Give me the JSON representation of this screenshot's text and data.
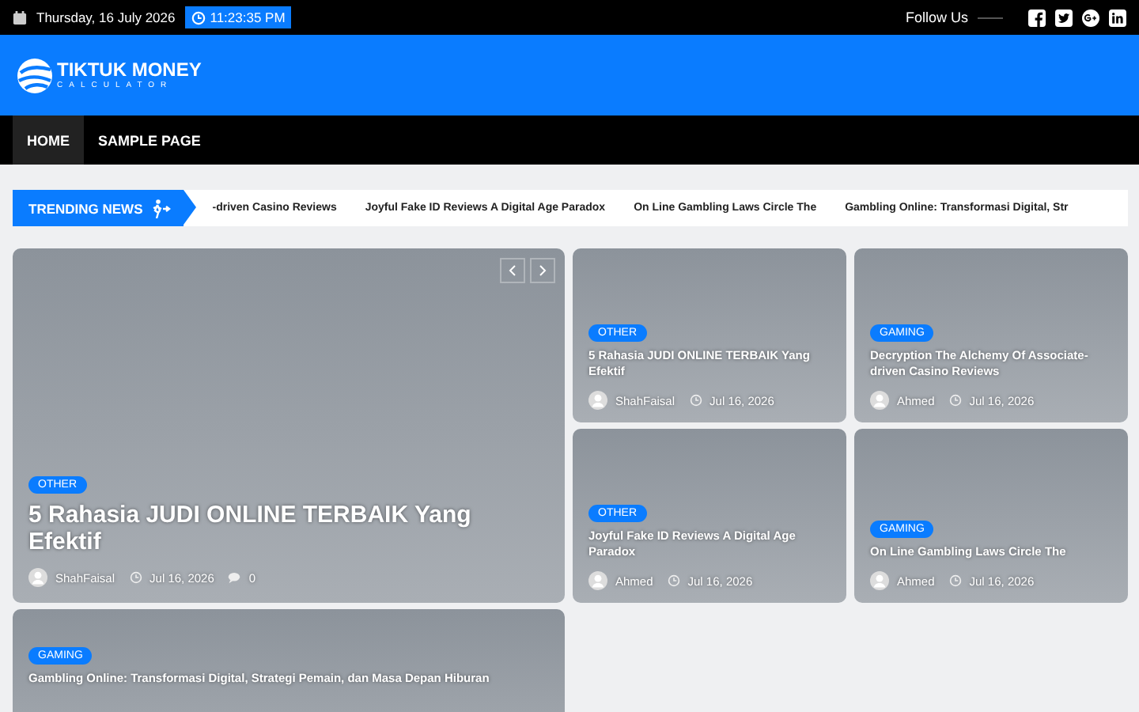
{
  "top_bar": {
    "date": "Thursday, 16 July 2026",
    "time": "11:23:35 PM",
    "follow_label": "Follow Us"
  },
  "header": {
    "logo_title": "TIKTUK MONEY",
    "logo_subtitle": "CALCULATOR"
  },
  "nav": [
    {
      "label": "HOME",
      "selected": true
    },
    {
      "label": "SAMPLE PAGE",
      "selected": false
    }
  ],
  "trending": {
    "label": "TRENDING NEWS",
    "items": [
      "-driven Casino Reviews",
      "Joyful Fake ID Reviews A Digital Age Paradox",
      "On Line Gambling Laws Circle The",
      "Gambling Online: Transformasi Digital, Str"
    ]
  },
  "featured": {
    "category": "OTHER",
    "title": "5 Rahasia JUDI ONLINE TERBAIK Yang Efektif",
    "author": "ShahFaisal",
    "date": "Jul 16, 2026",
    "comments": "0"
  },
  "posts": [
    {
      "category": "OTHER",
      "title": "5 Rahasia JUDI ONLINE TERBAIK Yang Efektif",
      "author": "ShahFaisal",
      "date": "Jul 16, 2026"
    },
    {
      "category": "GAMING",
      "title": "Decryption The Alchemy Of Associate-driven Casino Reviews",
      "author": "Ahmed",
      "date": "Jul 16, 2026"
    },
    {
      "category": "OTHER",
      "title": "Joyful Fake ID Reviews A Digital Age Paradox",
      "author": "Ahmed",
      "date": "Jul 16, 2026"
    },
    {
      "category": "GAMING",
      "title": "On Line Gambling Laws Circle The",
      "author": "Ahmed",
      "date": "Jul 16, 2026"
    },
    {
      "category": "GAMING",
      "title": "Gambling Online: Transformasi Digital, Strategi Pemain, dan Masa Depan Hiburan"
    }
  ]
}
